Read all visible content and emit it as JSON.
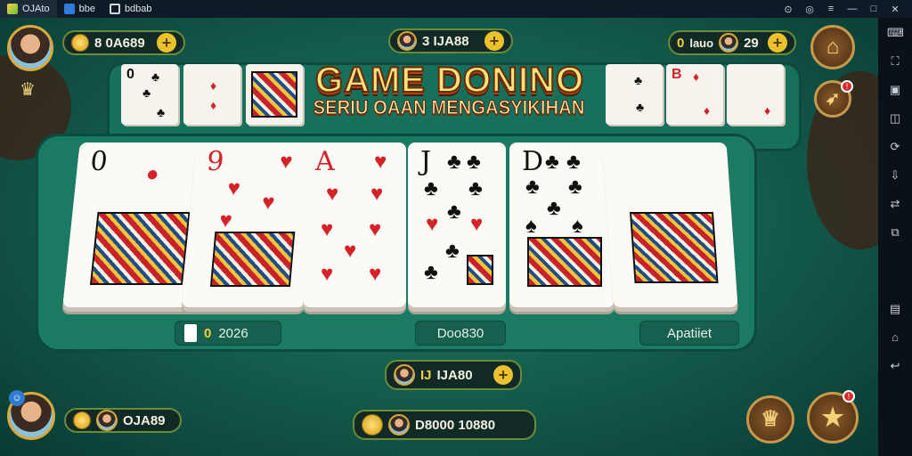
{
  "titlebar": {
    "tabs": [
      {
        "label": "OJAto",
        "icon": "app-logo-icon"
      },
      {
        "label": "bbe",
        "icon": "window-icon"
      },
      {
        "label": "bdbab",
        "icon": "page-icon"
      }
    ],
    "controls": [
      "⊙",
      "◎",
      "≡",
      "—",
      "□",
      "✕"
    ]
  },
  "header": {
    "player_coins": "8 0A689",
    "center_coins": "3 IJA88",
    "right_badge": "0",
    "right_label": "lauo",
    "right_count": "29"
  },
  "title": {
    "main": "GAME DONINO",
    "sub": "SERIU OAAN MENGASYIKIHAN"
  },
  "top_row_cards": [
    {
      "rank": "0",
      "color": "blk"
    },
    {
      "rank": "",
      "color": "red"
    },
    {
      "rank": "",
      "color": "red"
    },
    {
      "rank": "",
      "color": "blk"
    },
    {
      "rank": "B",
      "color": "red"
    },
    {
      "rank": "",
      "color": "red"
    }
  ],
  "main_cards": [
    {
      "rank": "0",
      "color": "red"
    },
    {
      "rank": "9",
      "color": "red"
    },
    {
      "rank": "A",
      "color": "red"
    },
    {
      "rank": "J",
      "color": "blk"
    },
    {
      "rank": "D",
      "color": "blk"
    },
    {
      "rank": "",
      "color": "red"
    }
  ],
  "table_bar": {
    "left_value": "2026",
    "left_badge": "0",
    "center": "Doo830",
    "right": "Apatiiet"
  },
  "center_bottom": {
    "label": "IJA80",
    "badge": "IJ"
  },
  "bottom_left": {
    "name": "OJA89"
  },
  "bottom_center": {
    "value": "D8000 10880"
  },
  "colors": {
    "felt": "#1a7a63",
    "gold": "#e9c22e",
    "wood": "#4a2d14"
  }
}
